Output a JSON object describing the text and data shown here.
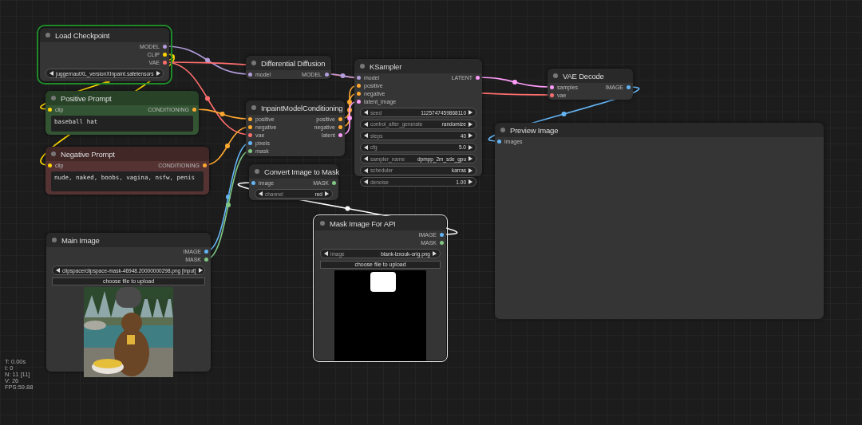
{
  "nodes": [
    {
      "title": "Load Checkpoint",
      "selected": false,
      "running": true,
      "color": "#353535",
      "outputs": [
        {
          "name": "MODEL",
          "color": "#b39ddb"
        },
        {
          "name": "CLIP",
          "color": "#ffd500"
        },
        {
          "name": "VAE",
          "color": "#ff6e6e"
        }
      ],
      "widgets": [
        {
          "kind": "combo",
          "value": "juggernautXL_versionXInpaint.safetensors"
        }
      ]
    },
    {
      "title": "Positive Prompt",
      "selected": false,
      "running": false,
      "color": "#335533",
      "inputs": [
        {
          "name": "clip",
          "color": "#ffd500"
        }
      ],
      "outputs": [
        {
          "name": "CONDITIONING",
          "color": "#ffa931"
        }
      ],
      "widgets": [
        {
          "kind": "text",
          "value": "baseball hat"
        }
      ]
    },
    {
      "title": "Negative Prompt",
      "selected": false,
      "running": false,
      "color": "#553333",
      "inputs": [
        {
          "name": "clip",
          "color": "#ffd500"
        }
      ],
      "outputs": [
        {
          "name": "CONDITIONING",
          "color": "#ffa931"
        }
      ],
      "widgets": [
        {
          "kind": "text",
          "value": "nude, naked, boobs, vagina, nsfw, penis"
        }
      ]
    },
    {
      "title": "Differential Diffusion",
      "selected": false,
      "running": false,
      "color": "#353535",
      "inputs": [
        {
          "name": "model",
          "color": "#b39ddb"
        }
      ],
      "outputs": [
        {
          "name": "MODEL",
          "color": "#b39ddb"
        }
      ]
    },
    {
      "title": "InpaintModelConditioning",
      "selected": false,
      "running": false,
      "color": "#353535",
      "inputs": [
        {
          "name": "positive",
          "color": "#ffa931"
        },
        {
          "name": "negative",
          "color": "#ffa931"
        },
        {
          "name": "vae",
          "color": "#ff6e6e"
        },
        {
          "name": "pixels",
          "color": "#64b5f6"
        },
        {
          "name": "mask",
          "color": "#81c784"
        }
      ],
      "outputs": [
        {
          "name": "positive",
          "color": "#ffa931"
        },
        {
          "name": "negative",
          "color": "#ffa931"
        },
        {
          "name": "latent",
          "color": "#ff9cf9"
        }
      ]
    },
    {
      "title": "Convert Image to Mask",
      "selected": false,
      "running": false,
      "color": "#353535",
      "inputs": [
        {
          "name": "image",
          "color": "#64b5f6"
        }
      ],
      "outputs": [
        {
          "name": "MASK",
          "color": "#81c784"
        }
      ],
      "widgets": [
        {
          "kind": "combo",
          "label": "channel",
          "value": "red"
        }
      ]
    },
    {
      "title": "KSampler",
      "selected": false,
      "running": false,
      "color": "#353535",
      "inputs": [
        {
          "name": "model",
          "color": "#b39ddb"
        },
        {
          "name": "positive",
          "color": "#ffa931"
        },
        {
          "name": "negative",
          "color": "#ffa931"
        },
        {
          "name": "latent_image",
          "color": "#ff9cf9"
        }
      ],
      "outputs": [
        {
          "name": "LATENT",
          "color": "#ff9cf9"
        }
      ],
      "widgets": [
        {
          "kind": "combo",
          "label": "seed",
          "value": "1125747459868110"
        },
        {
          "kind": "combo",
          "label": "control_after_generate",
          "value": "randomize"
        },
        {
          "kind": "combo",
          "label": "steps",
          "value": "40"
        },
        {
          "kind": "combo",
          "label": "cfg",
          "value": "5.0"
        },
        {
          "kind": "combo",
          "label": "sampler_name",
          "value": "dpmpp_2m_sde_gpu"
        },
        {
          "kind": "combo",
          "label": "scheduler",
          "value": "karras"
        },
        {
          "kind": "combo",
          "label": "denoise",
          "value": "1.00"
        }
      ]
    },
    {
      "title": "VAE Decode",
      "selected": false,
      "running": false,
      "color": "#353535",
      "inputs": [
        {
          "name": "samples",
          "color": "#ff9cf9"
        },
        {
          "name": "vae",
          "color": "#ff6e6e"
        }
      ],
      "outputs": [
        {
          "name": "IMAGE",
          "color": "#64b5f6"
        }
      ]
    },
    {
      "title": "Preview Image",
      "selected": false,
      "running": false,
      "color": "#353535",
      "inputs": [
        {
          "name": "images",
          "color": "#64b5f6"
        }
      ]
    },
    {
      "title": "Main Image",
      "selected": false,
      "running": false,
      "color": "#353535",
      "outputs": [
        {
          "name": "IMAGE",
          "color": "#64b5f6"
        },
        {
          "name": "MASK",
          "color": "#81c784"
        }
      ],
      "widgets": [
        {
          "kind": "combo",
          "value": "clipspace/clipspace-mask-46948.20000000298.png [input]"
        },
        {
          "kind": "button",
          "label": "choose file to upload"
        },
        {
          "kind": "picture"
        }
      ]
    },
    {
      "title": "Mask Image For API",
      "selected": true,
      "running": false,
      "color": "#353535",
      "outputs": [
        {
          "name": "IMAGE",
          "color": "#64b5f6"
        },
        {
          "name": "MASK",
          "color": "#81c784"
        }
      ],
      "widgets": [
        {
          "kind": "combo",
          "label": "image",
          "value": "blank-lzxouk-orig.png"
        },
        {
          "kind": "button",
          "label": "choose file to upload"
        },
        {
          "kind": "mask"
        }
      ]
    }
  ],
  "stats": [
    "T: 0.00s",
    "I: 0",
    "N: 11 [11]",
    "V: 26",
    "FPS:59.88"
  ]
}
